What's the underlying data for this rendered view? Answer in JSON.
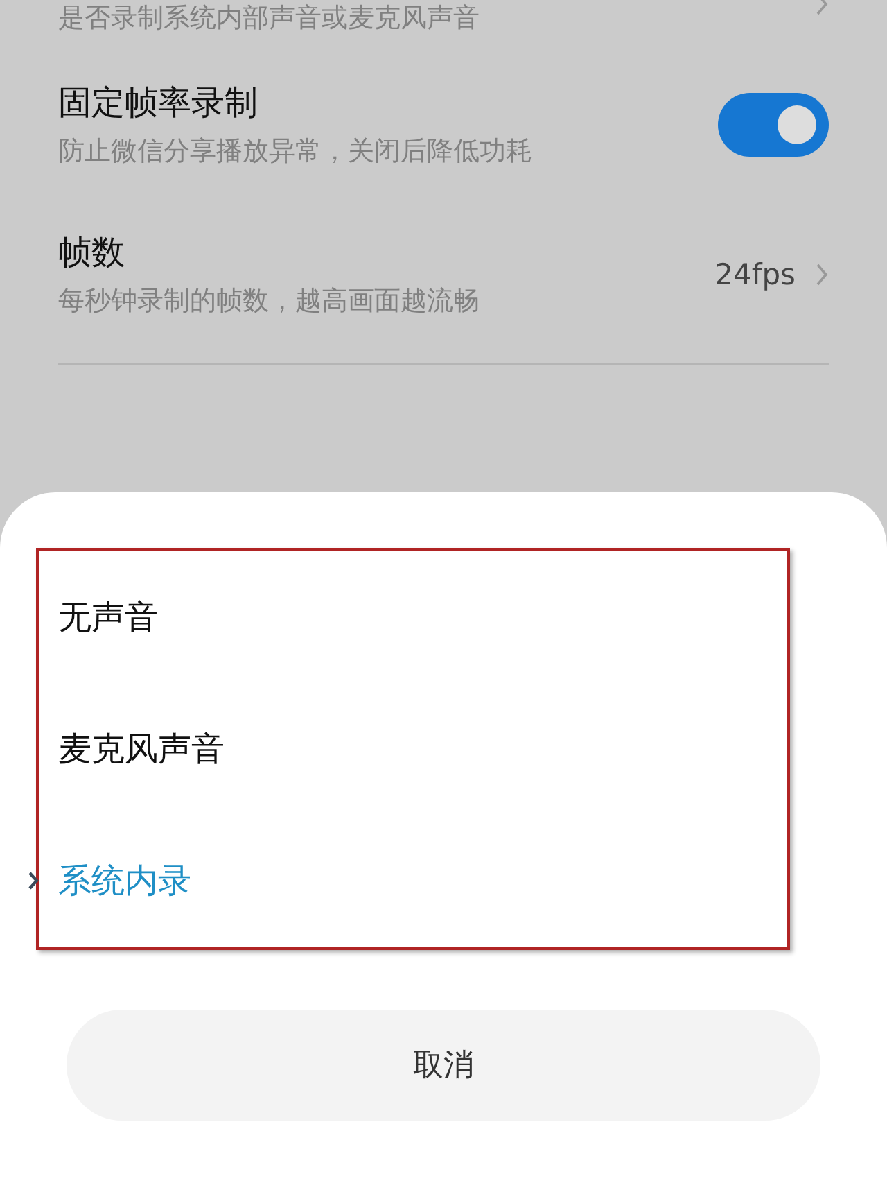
{
  "settings": [
    {
      "kind": "link",
      "subtitle": "是否录制系统内部声音或麦克风声音"
    },
    {
      "kind": "toggle",
      "title": "固定帧率录制",
      "subtitle": "防止微信分享播放异常，关闭后降低功耗",
      "on": true
    },
    {
      "kind": "link",
      "title": "帧数",
      "subtitle": "每秒钟录制的帧数，越高画面越流畅",
      "value": "24fps"
    }
  ],
  "sheet": {
    "options": [
      {
        "label": "无声音",
        "selected": false
      },
      {
        "label": "麦克风声音",
        "selected": false
      },
      {
        "label": "系统内录",
        "selected": true
      }
    ],
    "cancel": "取消"
  }
}
